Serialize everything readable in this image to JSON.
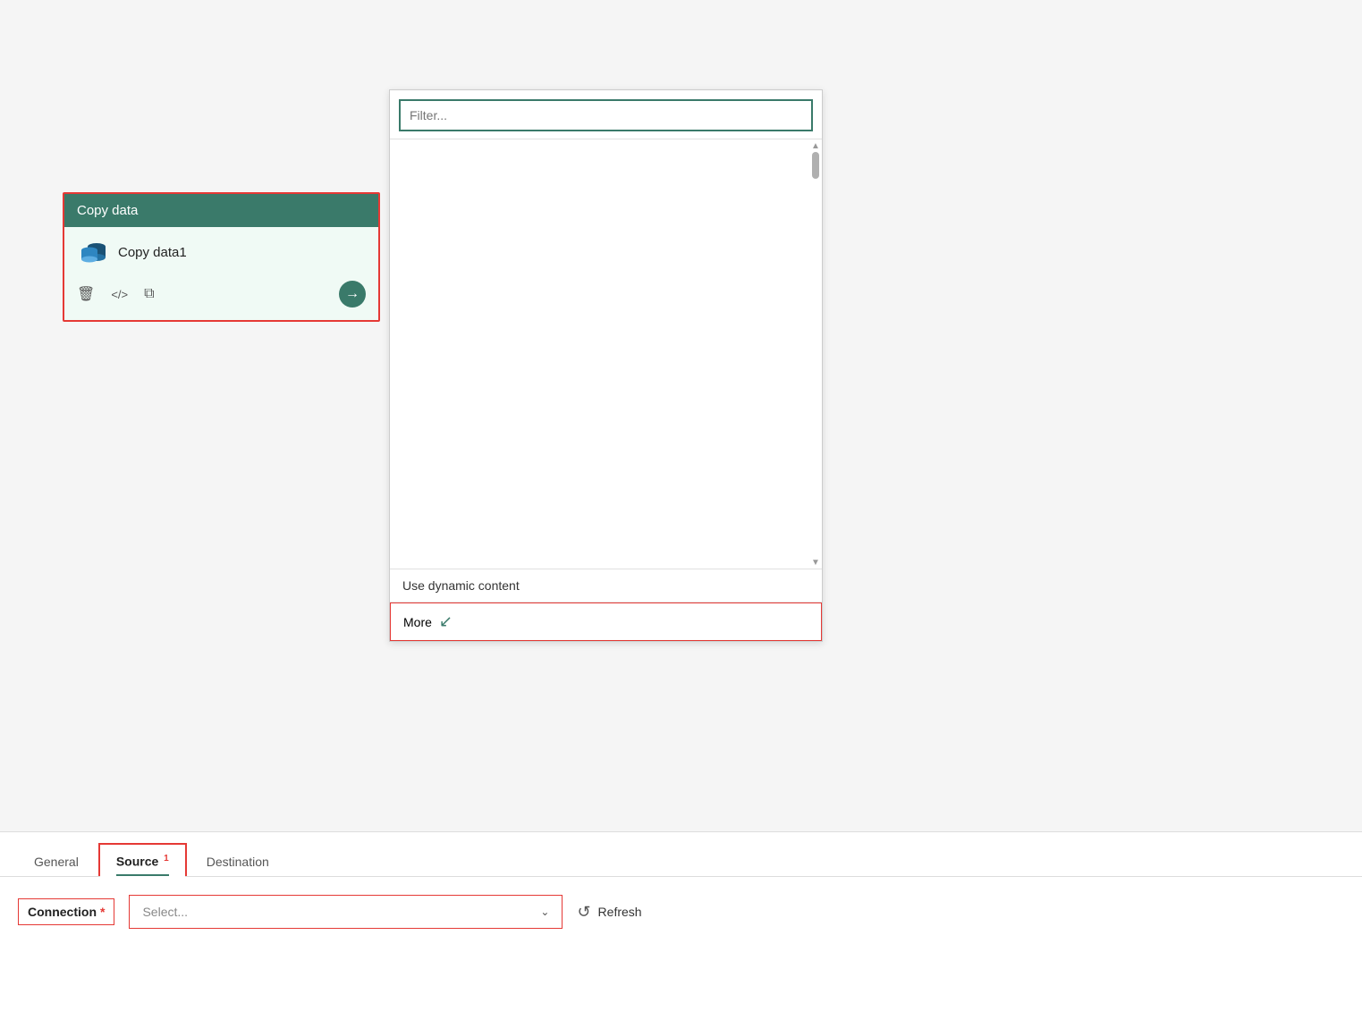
{
  "canvas": {
    "background": "#f0f0f0"
  },
  "copy_data_card": {
    "header": "Copy data",
    "item_name": "Copy data1",
    "delete_icon": "🗑",
    "code_icon": "</>",
    "copy_icon": "⧉",
    "arrow_icon": "→"
  },
  "dropdown_panel": {
    "filter_placeholder": "Filter...",
    "use_dynamic_content": "Use dynamic content",
    "more_label": "More"
  },
  "bottom_panel": {
    "tabs": [
      {
        "label": "General",
        "active": false,
        "badge": ""
      },
      {
        "label": "Source",
        "active": true,
        "badge": "1"
      },
      {
        "label": "Destination",
        "active": false,
        "badge": ""
      }
    ],
    "connection_label": "Connection",
    "required": "*",
    "select_placeholder": "Select...",
    "refresh_label": "Refresh"
  }
}
